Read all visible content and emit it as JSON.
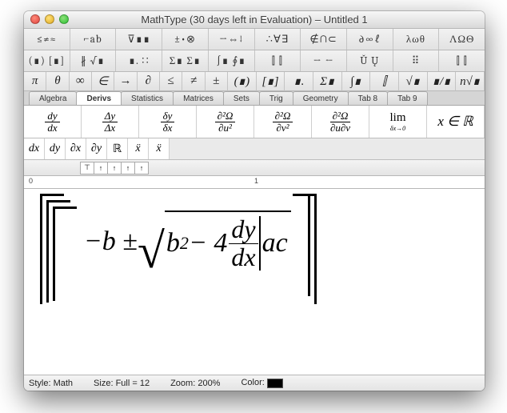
{
  "window": {
    "title": "MathType (30 days left in Evaluation) – Untitled 1"
  },
  "toolrow1": [
    "≤≠≈",
    "⌐ab",
    "⊽∎∎",
    "±•⊗",
    "→⇔↓",
    "∴∀∃",
    "∉∩⊂",
    "∂∞ℓ",
    "λωθ",
    "ΛΩΘ"
  ],
  "toolrow2": [
    "(∎) [∎]",
    "∦ √∎",
    "∎. ∷",
    "Σ∎ Σ∎",
    "∫∎ ∮∎",
    "⫿ ⫿",
    "→ ←",
    "Ǔ Ų",
    "⠿",
    "⫿ ⫿"
  ],
  "toolrow3_left": [
    "π",
    "θ",
    "∞",
    "∈",
    "→",
    "∂",
    "≤",
    "≠",
    "±"
  ],
  "toolrow3_right": [
    "(∎)",
    "[∎]",
    "∎.",
    "Σ∎",
    "∫∎",
    "⫿",
    "√∎",
    "∎/∎",
    "n√∎"
  ],
  "tabs": [
    "Algebra",
    "Derivs",
    "Statistics",
    "Matrices",
    "Sets",
    "Trig",
    "Geometry",
    "Tab 8",
    "Tab 9"
  ],
  "active_tab": 1,
  "derivs_row1": [
    {
      "num": "dy",
      "den": "dx"
    },
    {
      "num": "Δy",
      "den": "Δx"
    },
    {
      "num": "δy",
      "den": "δx"
    },
    {
      "num": "∂²Ω",
      "den": "∂u²"
    },
    {
      "num": "∂²Ω",
      "den": "∂v²"
    },
    {
      "num": "∂²Ω",
      "den": "∂u∂v"
    },
    {
      "lim_top": "lim",
      "lim_bot": "δx→0"
    },
    {
      "text": "x ∈ ℝ"
    }
  ],
  "derivs_row2": [
    "dx",
    "dy",
    "∂x",
    "∂y",
    "ℝ",
    "ẍ",
    "ẍ"
  ],
  "toolstrip": [
    "⊤",
    "↑",
    "↑",
    "↑",
    "↑"
  ],
  "ruler": {
    "mark0": "0",
    "mark1": "1"
  },
  "equation": {
    "before_sqrt": "−b ± ",
    "sqrt_first": "b",
    "sqrt_exp": "2",
    "sqrt_mid": " − 4",
    "frac_num": "dy",
    "frac_den": "dx",
    "after_frac": "ac"
  },
  "status": {
    "style_label": "Style:",
    "style_value": "Math",
    "size_label": "Size:",
    "size_value": "Full = 12",
    "zoom_label": "Zoom:",
    "zoom_value": "200%",
    "color_label": "Color:"
  }
}
